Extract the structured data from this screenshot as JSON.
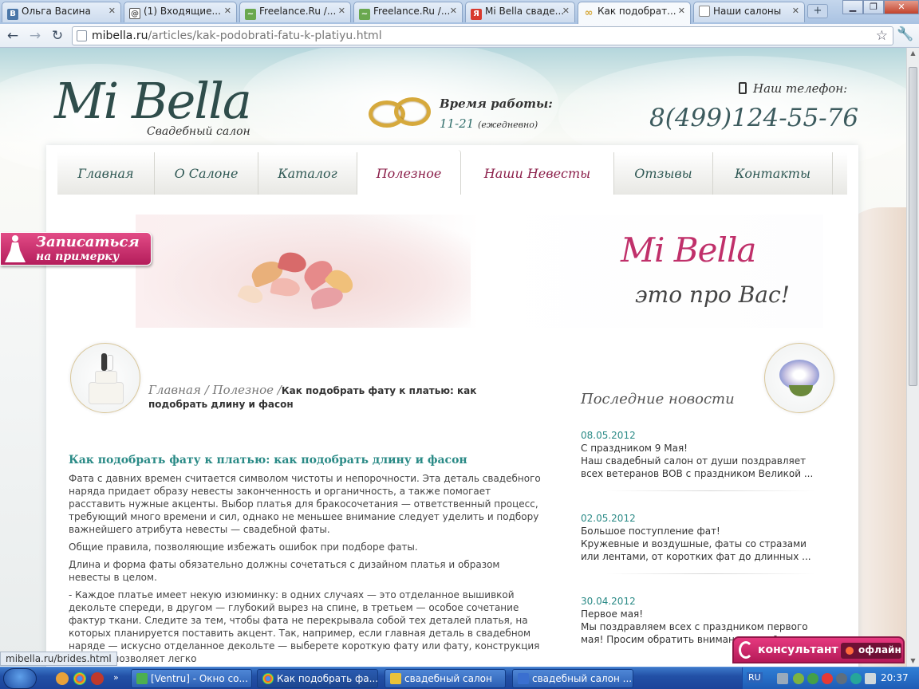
{
  "browser": {
    "tabs": [
      {
        "label": "Ольга Васина",
        "icon": "vk-icon",
        "color": "#4a76a8"
      },
      {
        "label": "(1) Входящие...",
        "icon": "mail-icon",
        "color": "#555555"
      },
      {
        "label": "Freelance.Ru /...",
        "icon": "freelance-icon",
        "color": "#6aa84f"
      },
      {
        "label": "Freelance.Ru /...",
        "icon": "freelance-icon",
        "color": "#6aa84f"
      },
      {
        "label": "Mi Bella сваде...",
        "icon": "yandex-icon",
        "color": "#d83a2e"
      },
      {
        "label": "Как подобрат...",
        "icon": "rings-icon",
        "color": "#d6a93c"
      },
      {
        "label": "Наши салоны",
        "icon": "page-icon",
        "color": "#ffffff"
      }
    ],
    "url_host": "mibella.ru",
    "url_path": "/articles/kak-podobrati-fatu-k-platiyu.html"
  },
  "header": {
    "logo": "Mi Bella",
    "logo_sub": "Свадебный салон",
    "hours_label": "Время работы:",
    "hours_value": "11-21",
    "hours_note": "(ежедневно)",
    "phone_label": "Наш телефон:",
    "phone_number": "8(499)124-55-76"
  },
  "menu": [
    {
      "label": "Главная"
    },
    {
      "label": "О Салоне"
    },
    {
      "label": "Каталог"
    },
    {
      "label": "Полезное"
    },
    {
      "label": "Наши Невесты"
    },
    {
      "label": "Отзывы"
    },
    {
      "label": "Контакты"
    }
  ],
  "fitting": {
    "line1": "Записаться",
    "line2": "на примерку"
  },
  "banner": {
    "title": "Mi Bella",
    "subtitle": "это про Вас!"
  },
  "breadcrumb": {
    "home": "Главная",
    "section": "Полезное",
    "current": "Как подобрать фату к платью: как подобрать длину и фасон"
  },
  "article": {
    "title": "Как подобрать фату к платью: как подобрать длину и фасон",
    "paragraphs": [
      "Фата с давних времен считается символом чистоты и непорочности. Эта деталь свадебного наряда придает образу невесты законченность и органичность, а также помогает расставить нужные акценты. Выбор платья для бракосочетания — ответственный процесс, требующий много времени и сил, однако не меньшее внимание следует уделить и подбору важнейшего атрибута невесты — свадебной фаты.",
      "Общие правила, позволяющие избежать ошибок при подборе фаты.",
      "Длина и форма фаты обязательно должны сочетаться с дизайном платья и образом невесты в целом.",
      "- Каждое платье имеет некую изюминку: в одних случаях — это отделанное вышивкой декольте спереди, в другом — глубокий вырез на спине, в третьем — особое сочетание фактур ткани. Следите за тем, чтобы фата не перекрывала собой тех деталей платья, на которых планируется поставить акцент. Так, например, если главная деталь в свадебном наряде — искусно отделанное декольте — выберете короткую фату или фату, конструкция которой позволяет легко"
    ]
  },
  "news": {
    "heading": "Последние новости",
    "items": [
      {
        "date": "08.05.2012",
        "title": "С праздником 9 Мая!",
        "text": "Наш свадебный салон от души поздравляет всех ветеранов ВОВ с праздником Великой ..."
      },
      {
        "date": "02.05.2012",
        "title": "Большое поступление фат!",
        "text": "Кружевные и воздушные, фаты со стразами или лентами, от коротких фат до длинных ..."
      },
      {
        "date": "30.04.2012",
        "title": "Первое мая!",
        "text": "Мы поздравляем всех с праздником первого мая! Просим обратить внимание, что 1"
      }
    ]
  },
  "status_url": "mibella.ru/brides.html",
  "consultant": {
    "label": "консультант",
    "status": "офлайн"
  },
  "taskbar": {
    "tasks": [
      {
        "label": "[Ventru] - Окно со...",
        "color": "#4caf50"
      },
      {
        "label": "Как подобрать фа...",
        "color": "#e8c23a"
      },
      {
        "label": "свадебный салон",
        "color": "#e8c23a"
      },
      {
        "label": "свадебный салон ...",
        "color": "#3a6fd0"
      }
    ],
    "lang": "RU",
    "clock": "20:37"
  },
  "colors": {
    "accent_teal": "#2a8a86",
    "accent_pink": "#c0306a",
    "menu_active": "#8b1f4a"
  }
}
